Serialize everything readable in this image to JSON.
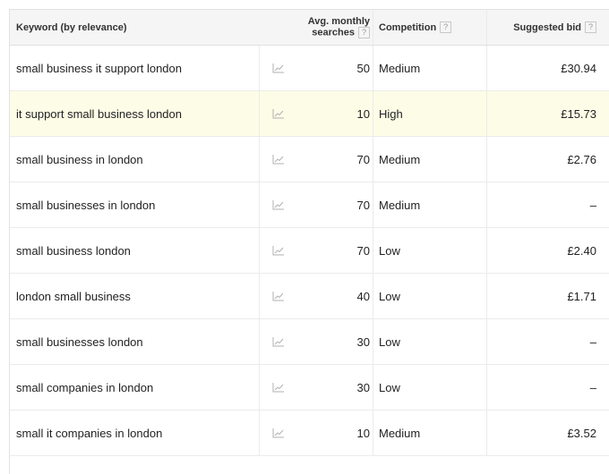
{
  "header": {
    "keyword": "Keyword (by relevance)",
    "searches_line1": "Avg. monthly",
    "searches_line2": "searches",
    "competition": "Competition",
    "bid": "Suggested bid",
    "help_glyph": "?"
  },
  "rows": [
    {
      "keyword": "small business it support london",
      "searches": "50",
      "competition": "Medium",
      "bid": "£30.94"
    },
    {
      "keyword": "it support small business london",
      "searches": "10",
      "competition": "High",
      "bid": "£15.73"
    },
    {
      "keyword": "small business in london",
      "searches": "70",
      "competition": "Medium",
      "bid": "£2.76"
    },
    {
      "keyword": "small businesses in london",
      "searches": "70",
      "competition": "Medium",
      "bid": "–"
    },
    {
      "keyword": "small business london",
      "searches": "70",
      "competition": "Low",
      "bid": "£2.40"
    },
    {
      "keyword": "london small business",
      "searches": "40",
      "competition": "Low",
      "bid": "£1.71"
    },
    {
      "keyword": "small businesses london",
      "searches": "30",
      "competition": "Low",
      "bid": "–"
    },
    {
      "keyword": "small companies in london",
      "searches": "30",
      "competition": "Low",
      "bid": "–"
    },
    {
      "keyword": "small it companies in london",
      "searches": "10",
      "competition": "Medium",
      "bid": "£3.52"
    }
  ],
  "colors": {
    "highlight_row": "#fdfde7",
    "header_bg": "#f5f5f5",
    "trend_icon": "#b0b0b0"
  },
  "icons": {
    "trend": "line-chart-icon",
    "help": "help-icon"
  }
}
